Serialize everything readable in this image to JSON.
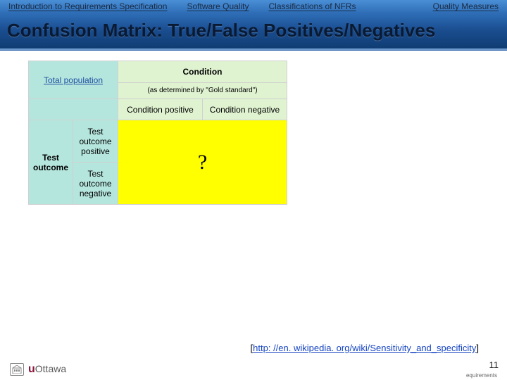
{
  "tabs": {
    "t1": "Introduction to Requirements Specification",
    "t2": "Software Quality",
    "t3": "Classifications of NFRs",
    "t4": "Quality Measures"
  },
  "title": "Confusion Matrix: True/False Positives/Negatives",
  "matrix": {
    "total_population": "Total population",
    "condition_head": "Condition",
    "condition_sub": "(as determined by \"Gold standard\")",
    "condition_pos": "Condition positive",
    "condition_neg": "Condition negative",
    "test_outcome": "Test outcome",
    "test_pos": "Test outcome positive",
    "test_neg": "Test outcome negative",
    "unknown": "?"
  },
  "source": {
    "prefix": "[",
    "url": "http: //en. wikipedia. org/wiki/Sensitivity_and_specificity",
    "suffix": "]"
  },
  "slide_number": "11",
  "logo_text": "Ottawa",
  "logo_u": "u",
  "crumb": "equirements"
}
